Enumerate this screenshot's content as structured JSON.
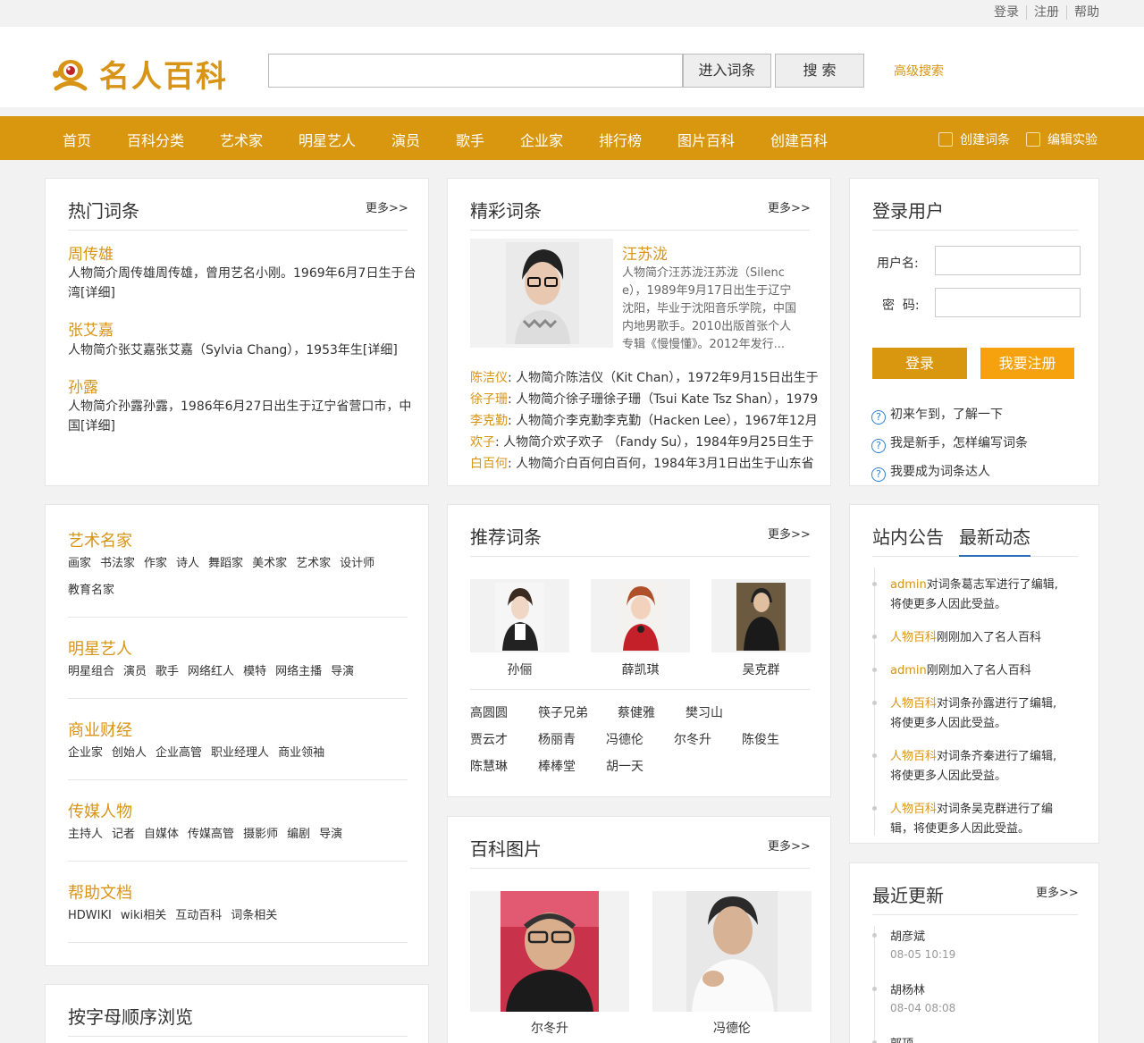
{
  "top_links": [
    "登录",
    "注册",
    "帮助"
  ],
  "brand": {
    "name": "名人百科",
    "accent": "#d89416"
  },
  "search": {
    "placeholder": "",
    "enter_label": "进入词条",
    "search_label": "搜 索",
    "advanced": "高级搜索"
  },
  "nav": {
    "items": [
      "首页",
      "百科分类",
      "艺术家",
      "明星艺人",
      "演员",
      "歌手",
      "企业家",
      "排行榜",
      "图片百科",
      "创建百科"
    ],
    "create": "创建词条",
    "edit": "编辑实验",
    "color": "#d8970f"
  },
  "hot": {
    "title": "热门词条",
    "more": "更多>>",
    "items": [
      {
        "name": "周传雄",
        "desc1": "人物简介周传雄周传雄，曾用艺名小刚。1969年6月7日生于台",
        "desc2": "湾[详细]"
      },
      {
        "name": "张艾嘉",
        "desc1": "人物简介张艾嘉张艾嘉（Sylvia Chang），1953年生[详细]",
        "desc2": ""
      },
      {
        "name": "孙露",
        "desc1": "人物简介孙露孙露，1986年6月27日出生于辽宁省营口市，中",
        "desc2": "国[详细]"
      }
    ]
  },
  "featured": {
    "title": "精彩词条",
    "more": "更多>>",
    "main": {
      "name": "汪苏泷",
      "lines": [
        "人物简介汪苏泷汪苏泷（Silenc",
        "e），1989年9月17日出生于辽宁",
        "沈阳，毕业于沈阳音乐学院，中国",
        "内地男歌手。2010出版首张个人",
        "专辑《慢慢懂》。2012年发行..."
      ]
    },
    "list": [
      {
        "name": "陈洁仪",
        "text": ": 人物简介陈洁仪（Kit Chan），1972年9月15日出生于"
      },
      {
        "name": "徐子珊",
        "text": ": 人物简介徐子珊徐子珊（Tsui Kate Tsz Shan），1979"
      },
      {
        "name": "李克勤",
        "text": ": 人物简介李克勤李克勤（Hacken Lee），1967年12月"
      },
      {
        "name": "欢子",
        "text": ": 人物简介欢子欢子 （Fandy Su），1984年9月25日生于"
      },
      {
        "name": "白百何",
        "text": ": 人物简介白百何白百何，1984年3月1日出生于山东省"
      }
    ]
  },
  "login": {
    "title": "登录用户",
    "user_label": "用户名:",
    "pwd_label": "密  码:",
    "login_btn": "登录",
    "register_btn": "我要注册",
    "help": [
      "初来乍到，了解一下",
      "我是新手，怎样编写词条",
      "我要成为词条达人"
    ]
  },
  "categories": [
    {
      "title": "艺术名家",
      "tags": [
        "画家",
        "书法家",
        "作家",
        "诗人",
        "舞蹈家",
        "美术家",
        "艺术家",
        "设计师"
      ],
      "tags2": [
        "教育名家"
      ]
    },
    {
      "title": "明星艺人",
      "tags": [
        "明星组合",
        "演员",
        "歌手",
        "网络红人",
        "模特",
        "网络主播",
        "导演"
      ],
      "tags2": []
    },
    {
      "title": "商业财经",
      "tags": [
        "企业家",
        "创始人",
        "企业高管",
        "职业经理人",
        "商业领袖"
      ],
      "tags2": []
    },
    {
      "title": "传媒人物",
      "tags": [
        "主持人",
        "记者",
        "自媒体",
        "传媒高管",
        "摄影师",
        "编剧",
        "导演"
      ],
      "tags2": []
    },
    {
      "title": "帮助文档",
      "tags": [
        "HDWIKI",
        "wiki相关",
        "互动百科",
        "词条相关"
      ],
      "tags2": []
    }
  ],
  "recommend": {
    "title": "推荐词条",
    "more": "更多>>",
    "photos": [
      "孙俪",
      "薛凯琪",
      "吴克群"
    ],
    "names": [
      [
        "高圆圆",
        "筷子兄弟",
        "蔡健雅",
        "樊习山"
      ],
      [
        "贾云才",
        "杨丽青",
        "冯德伦",
        "尔冬升",
        "陈俊生"
      ],
      [
        "陈慧琳",
        "棒棒堂",
        "胡一天"
      ]
    ]
  },
  "pictures": {
    "title": "百科图片",
    "more": "更多>>",
    "items": [
      "尔冬升",
      "冯德伦"
    ]
  },
  "alpha": {
    "title": "按字母顺序浏览"
  },
  "notice": {
    "tab1": "站内公告",
    "tab2": "最新动态",
    "feed": [
      {
        "who": "admin",
        "l1": "对词条葛志军进行了编辑,",
        "l2": "将使更多人因此受益。"
      },
      {
        "who": "人物百科",
        "l1": "刚刚加入了名人百科",
        "l2": ""
      },
      {
        "who": "admin",
        "l1": "刚刚加入了名人百科",
        "l2": ""
      },
      {
        "who": "人物百科",
        "l1": "对词条孙露进行了编辑,",
        "l2": "将使更多人因此受益。"
      },
      {
        "who": "人物百科",
        "l1": "对词条齐秦进行了编辑,",
        "l2": "将使更多人因此受益。"
      },
      {
        "who": "人物百科",
        "l1": "对词条吴克群进行了编",
        "l2": "辑，将使更多人因此受益。"
      }
    ]
  },
  "recent": {
    "title": "最近更新",
    "more": "更多>>",
    "items": [
      {
        "name": "胡彦斌",
        "time": "08-05 10:19"
      },
      {
        "name": "胡杨林",
        "time": "08-04 08:08"
      },
      {
        "name": "郭顶",
        "time": ""
      }
    ]
  }
}
